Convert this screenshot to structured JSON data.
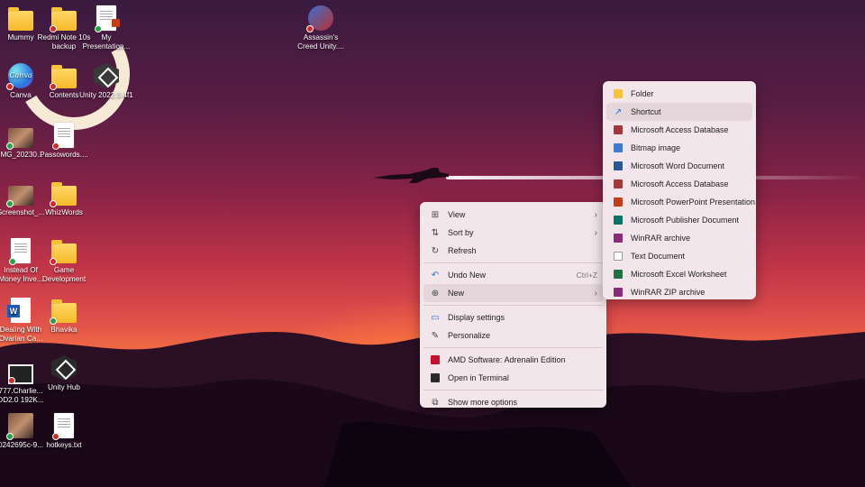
{
  "desktop_icons": [
    {
      "label": "Mummy",
      "type": "folder"
    },
    {
      "label": "Redmi Note 10s backup",
      "type": "folder"
    },
    {
      "label": "My Presentation...",
      "type": "ppt"
    },
    {
      "label": "Canva",
      "type": "canva"
    },
    {
      "label": "Contents",
      "type": "folder"
    },
    {
      "label": "Unity 2022.3.4f1",
      "type": "unity"
    },
    {
      "label": "IMG_20230...",
      "type": "photo"
    },
    {
      "label": "Passowords....",
      "type": "doc"
    },
    {
      "label": "Screenshot_...",
      "type": "photo"
    },
    {
      "label": "WhizWords",
      "type": "folder"
    },
    {
      "label": "Instead Of Money Inve...",
      "type": "doc"
    },
    {
      "label": "Game Development",
      "type": "folder"
    },
    {
      "label": "Dealing With Ovarian Ca...",
      "type": "word"
    },
    {
      "label": "Bhavika",
      "type": "folder"
    },
    {
      "label": "777.Charlie... DD2.0 192K...",
      "type": "video"
    },
    {
      "label": "Unity Hub",
      "type": "unity"
    },
    {
      "label": "0242695c-9...",
      "type": "photo"
    },
    {
      "label": "hotkeys.txt",
      "type": "doc"
    },
    {
      "label": "Assassin's Creed Unity....",
      "type": "game"
    }
  ],
  "context_menu": {
    "items": [
      {
        "label": "View",
        "icon": "grid-icon",
        "submenu": true
      },
      {
        "label": "Sort by",
        "icon": "sort-icon",
        "submenu": true
      },
      {
        "label": "Refresh",
        "icon": "refresh-icon"
      },
      {
        "label": "Undo New",
        "icon": "undo-icon",
        "shortcut": "Ctrl+Z"
      },
      {
        "label": "New",
        "icon": "plus-circle-icon",
        "submenu": true
      },
      {
        "label": "Display settings",
        "icon": "display-icon"
      },
      {
        "label": "Personalize",
        "icon": "brush-icon"
      },
      {
        "label": "AMD Software: Adrenalin Edition",
        "icon": "amd-icon"
      },
      {
        "label": "Open in Terminal",
        "icon": "terminal-icon"
      },
      {
        "label": "Show more options",
        "icon": "expand-icon"
      }
    ]
  },
  "new_submenu": {
    "items": [
      {
        "label": "Folder",
        "icon": "folder-icon",
        "color": "#f5c23a"
      },
      {
        "label": "Shortcut",
        "icon": "shortcut-icon",
        "color": "#2a6fd6"
      },
      {
        "label": "Microsoft Access Database",
        "icon": "access-icon",
        "color": "#a4373a"
      },
      {
        "label": "Bitmap image",
        "icon": "bitmap-icon",
        "color": "#3a7bd5"
      },
      {
        "label": "Microsoft Word Document",
        "icon": "word-icon",
        "color": "#2b579a"
      },
      {
        "label": "Microsoft Access Database",
        "icon": "access-icon",
        "color": "#a4373a"
      },
      {
        "label": "Microsoft PowerPoint Presentation",
        "icon": "powerpoint-icon",
        "color": "#c43e1c"
      },
      {
        "label": "Microsoft Publisher Document",
        "icon": "publisher-icon",
        "color": "#077568"
      },
      {
        "label": "WinRAR archive",
        "icon": "winrar-icon",
        "color": "#8a2b7a"
      },
      {
        "label": "Text Document",
        "icon": "text-doc-icon",
        "color": "#9a9a9a"
      },
      {
        "label": "Microsoft Excel Worksheet",
        "icon": "excel-icon",
        "color": "#217346"
      },
      {
        "label": "WinRAR ZIP archive",
        "icon": "winrar-zip-icon",
        "color": "#8a2b7a"
      }
    ]
  }
}
